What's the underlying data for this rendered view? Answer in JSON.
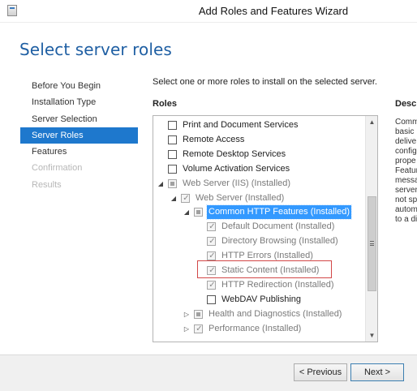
{
  "window": {
    "title": "Add Roles and Features Wizard"
  },
  "page": {
    "title": "Select server roles",
    "instruction": "Select one or more roles to install on the selected server.",
    "roles_label": "Roles",
    "description_label": "Descri",
    "description_lines": [
      "Comm",
      "basic I",
      "delive",
      "config",
      "prope",
      "Featur",
      "messa",
      "server",
      "not sp",
      "autom",
      "to a di"
    ]
  },
  "nav": [
    {
      "label": "Before You Begin",
      "state": "normal"
    },
    {
      "label": "Installation Type",
      "state": "normal"
    },
    {
      "label": "Server Selection",
      "state": "normal"
    },
    {
      "label": "Server Roles",
      "state": "active"
    },
    {
      "label": "Features",
      "state": "normal"
    },
    {
      "label": "Confirmation",
      "state": "disabled"
    },
    {
      "label": "Results",
      "state": "disabled"
    }
  ],
  "roles": [
    {
      "label": "Print and Document Services",
      "level": 0,
      "expander": "",
      "check": "unchecked",
      "disabled": false,
      "selected": false
    },
    {
      "label": "Remote Access",
      "level": 0,
      "expander": "",
      "check": "unchecked",
      "disabled": false,
      "selected": false
    },
    {
      "label": "Remote Desktop Services",
      "level": 0,
      "expander": "",
      "check": "unchecked",
      "disabled": false,
      "selected": false
    },
    {
      "label": "Volume Activation Services",
      "level": 0,
      "expander": "",
      "check": "unchecked",
      "disabled": false,
      "selected": false
    },
    {
      "label": "Web Server (IIS) (Installed)",
      "level": 0,
      "expander": "expanded",
      "check": "partial",
      "disabled": true,
      "selected": false
    },
    {
      "label": "Web Server (Installed)",
      "level": 1,
      "expander": "expanded",
      "check": "checked",
      "disabled": true,
      "selected": false
    },
    {
      "label": "Common HTTP Features (Installed)",
      "level": 2,
      "expander": "expanded",
      "check": "partial",
      "disabled": true,
      "selected": true
    },
    {
      "label": "Default Document (Installed)",
      "level": 3,
      "expander": "",
      "check": "checked",
      "disabled": true,
      "selected": false
    },
    {
      "label": "Directory Browsing (Installed)",
      "level": 3,
      "expander": "",
      "check": "checked",
      "disabled": true,
      "selected": false
    },
    {
      "label": "HTTP Errors (Installed)",
      "level": 3,
      "expander": "",
      "check": "checked",
      "disabled": true,
      "selected": false
    },
    {
      "label": "Static Content (Installed)",
      "level": 3,
      "expander": "",
      "check": "checked",
      "disabled": true,
      "selected": false
    },
    {
      "label": "HTTP Redirection (Installed)",
      "level": 3,
      "expander": "",
      "check": "checked",
      "disabled": true,
      "selected": false
    },
    {
      "label": "WebDAV Publishing",
      "level": 3,
      "expander": "",
      "check": "unchecked",
      "disabled": false,
      "selected": false
    },
    {
      "label": "Health and Diagnostics (Installed)",
      "level": 2,
      "expander": "collapsed",
      "check": "partial",
      "disabled": true,
      "selected": false
    },
    {
      "label": "Performance (Installed)",
      "level": 2,
      "expander": "collapsed",
      "check": "checked",
      "disabled": true,
      "selected": false
    }
  ],
  "buttons": {
    "previous": "< Previous",
    "next": "Next >"
  },
  "colors": {
    "accent": "#1e78cd",
    "title": "#1f5fa3",
    "selection": "#3399ff",
    "highlight_border": "#d24747"
  }
}
